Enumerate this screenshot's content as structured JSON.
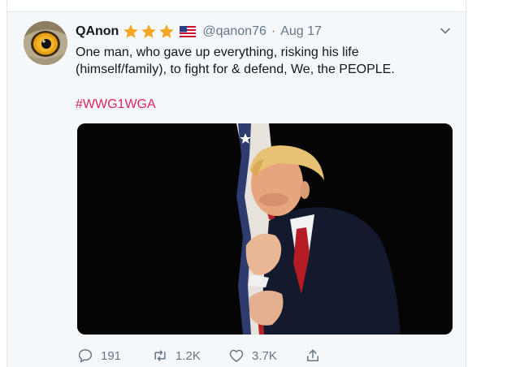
{
  "tweet": {
    "display_name": "QAnon",
    "badges": [
      "star-icon",
      "star-icon",
      "star-icon",
      "us-flag-icon"
    ],
    "handle": "@qanon76",
    "separator": "·",
    "date": "Aug 17",
    "text": "One man, who gave up everything, risking his life (himself/family), to fight for & defend, We, the PEOPLE.",
    "hashtag": "#WWG1WGA",
    "media_icon": "photo-image"
  },
  "actions": {
    "reply_count": "191",
    "retweet_count": "1.2K",
    "like_count": "3.7K",
    "icons": [
      "reply-icon",
      "retweet-icon",
      "like-icon",
      "share-icon"
    ]
  },
  "colors": {
    "name": "#14171a",
    "secondary": "#657786",
    "hashtag": "#e0245e",
    "star": "#f5a623",
    "card_background": "#f5f8fa"
  }
}
